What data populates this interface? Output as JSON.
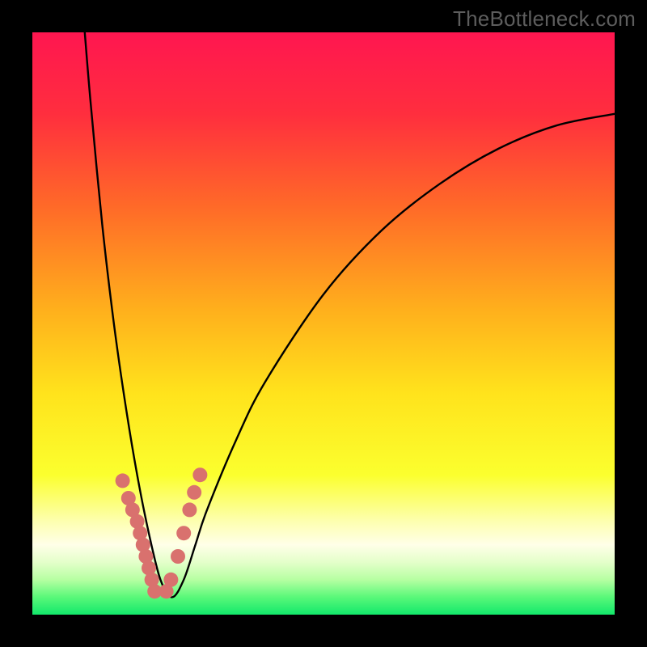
{
  "watermark": "TheBottleneck.com",
  "chart_data": {
    "type": "line",
    "title": "",
    "xlabel": "",
    "ylabel": "",
    "xlim": [
      0,
      100
    ],
    "ylim": [
      0,
      100
    ],
    "grid": false,
    "curve_note": "V-shaped curve: steep descent on the left, minimum near x≈22, rising concave-down branch to the right; values estimated from pixel positions",
    "series": [
      {
        "name": "curve",
        "x": [
          9,
          10,
          12,
          14,
          16,
          18,
          20,
          22,
          24,
          26,
          28,
          30,
          35,
          40,
          50,
          60,
          70,
          80,
          90,
          100
        ],
        "y": [
          100,
          88,
          67,
          50,
          36,
          24,
          14,
          6,
          3,
          6,
          12,
          18,
          30,
          40,
          55,
          66,
          74,
          80,
          84,
          86
        ]
      },
      {
        "name": "markers-left",
        "x": [
          15.5,
          16.5,
          17.2,
          18.0,
          18.5,
          19.0,
          19.5,
          20.0,
          20.5,
          21.0
        ],
        "y": [
          23,
          20,
          18,
          16,
          14,
          12,
          10,
          8,
          6,
          4
        ]
      },
      {
        "name": "markers-right",
        "x": [
          23.0,
          23.8,
          25.0,
          26.0,
          27.0,
          27.8,
          28.8
        ],
        "y": [
          4,
          6,
          10,
          14,
          18,
          21,
          24
        ]
      }
    ],
    "gradient_stops": [
      {
        "pct": 0,
        "color": "#ff1650"
      },
      {
        "pct": 14,
        "color": "#ff2e3e"
      },
      {
        "pct": 30,
        "color": "#ff6a28"
      },
      {
        "pct": 48,
        "color": "#ffb11c"
      },
      {
        "pct": 62,
        "color": "#ffe31c"
      },
      {
        "pct": 76,
        "color": "#fbff2e"
      },
      {
        "pct": 84,
        "color": "#fdffb0"
      },
      {
        "pct": 88,
        "color": "#ffffe8"
      },
      {
        "pct": 91,
        "color": "#e4ffca"
      },
      {
        "pct": 94,
        "color": "#b6ffa2"
      },
      {
        "pct": 97,
        "color": "#59f879"
      },
      {
        "pct": 100,
        "color": "#12e86b"
      }
    ],
    "marker_color": "#d9716e",
    "curve_color": "#000000"
  }
}
